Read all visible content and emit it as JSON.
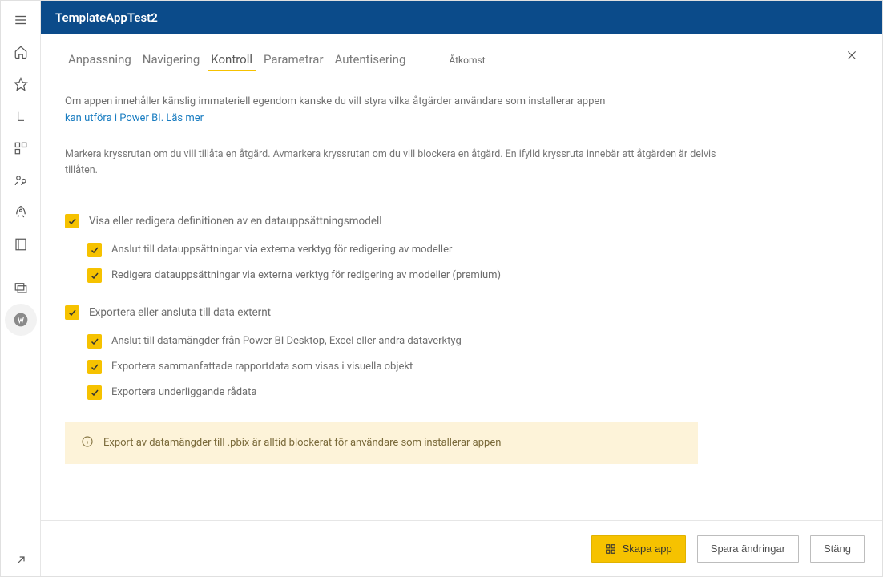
{
  "header": {
    "title": "TemplateAppTest2"
  },
  "tabs": {
    "items": [
      {
        "label": "Anpassning"
      },
      {
        "label": "Navigering"
      },
      {
        "label": "Kontroll"
      },
      {
        "label": "Parametrar"
      },
      {
        "label": "Autentisering"
      }
    ],
    "extra": "Åtkomst"
  },
  "intro": {
    "line1": "Om appen innehåller känslig immateriell egendom kanske du vill styra vilka åtgärder användare som installerar appen",
    "link": "kan utföra i Power BI. Läs mer",
    "sub": "Markera kryssrutan om du vill tillåta en åtgärd. Avmarkera kryssrutan om du vill blockera en åtgärd. En ifylld kryssruta innebär att åtgärden är delvis tillåten."
  },
  "group1": {
    "parent": "Visa eller redigera definitionen av en datauppsättningsmodell",
    "children": [
      "Anslut till datauppsättningar via externa verktyg för redigering av modeller",
      "Redigera datauppsättningar via externa verktyg för redigering av modeller (premium)"
    ]
  },
  "group2": {
    "parent": "Exportera eller ansluta till data externt",
    "children": [
      "Anslut till datamängder från Power BI Desktop, Excel eller andra dataverktyg",
      "Exportera sammanfattade rapportdata som visas i visuella objekt",
      "Exportera underliggande rådata"
    ]
  },
  "banner": "Export av datamängder till .pbix är alltid blockerat för användare som installerar appen",
  "footer": {
    "create": "Skapa app",
    "save": "Spara ändringar",
    "close": "Stäng"
  }
}
